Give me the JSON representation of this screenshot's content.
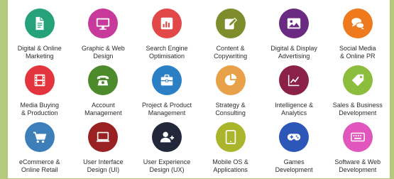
{
  "services": [
    {
      "icon": "document-icon",
      "color": "#26a27b",
      "label_line1": "Digital & Online",
      "label_line2": "Marketing"
    },
    {
      "icon": "monitor-icon",
      "color": "#c7399a",
      "label_line1": "Graphic & Web",
      "label_line2": "Design"
    },
    {
      "icon": "bar-chart-icon",
      "color": "#e24848",
      "label_line1": "Search Engine",
      "label_line2": "Optimisation"
    },
    {
      "icon": "pencil-edit-icon",
      "color": "#7f8c2c",
      "label_line1": "Content &",
      "label_line2": "Copywriting"
    },
    {
      "icon": "image-icon",
      "color": "#6a2a82",
      "label_line1": "Digital & Display",
      "label_line2": "Advertising"
    },
    {
      "icon": "chat-bubbles-icon",
      "color": "#ef7a1d",
      "label_line1": "Social Media",
      "label_line2": "& Online PR"
    },
    {
      "icon": "film-icon",
      "color": "#e2353d",
      "label_line1": "Media Buying",
      "label_line2": "& Production"
    },
    {
      "icon": "telephone-icon",
      "color": "#4c8a2b",
      "label_line1": "Account",
      "label_line2": "Management"
    },
    {
      "icon": "briefcase-icon",
      "color": "#2b80c5",
      "label_line1": "Project & Product",
      "label_line2": "Management"
    },
    {
      "icon": "pie-chart-icon",
      "color": "#e8a049",
      "label_line1": "Strategy &",
      "label_line2": "Consulting"
    },
    {
      "icon": "line-chart-icon",
      "color": "#8c2147",
      "label_line1": "Intelligence &",
      "label_line2": "Analytics"
    },
    {
      "icon": "tag-icon",
      "color": "#8cbd3c",
      "label_line1": "Sales & Business",
      "label_line2": "Development"
    },
    {
      "icon": "shopping-cart-icon",
      "color": "#3d7fb8",
      "label_line1": "eCommerce &",
      "label_line2": "Online Retail"
    },
    {
      "icon": "laptop-icon",
      "color": "#9a2121",
      "label_line1": "User Interface",
      "label_line2": "Design (UI)"
    },
    {
      "icon": "add-user-icon",
      "color": "#22283a",
      "label_line1": "User Experience",
      "label_line2": "Design (UX)"
    },
    {
      "icon": "tablet-icon",
      "color": "#aab52b",
      "label_line1": "Mobile OS &",
      "label_line2": "Applications"
    },
    {
      "icon": "gamepad-icon",
      "color": "#2c56b8",
      "label_line1": "Games",
      "label_line2": "Development"
    },
    {
      "icon": "keyboard-icon",
      "color": "#e156bd",
      "label_line1": "Software & Web",
      "label_line2": "Development"
    }
  ]
}
